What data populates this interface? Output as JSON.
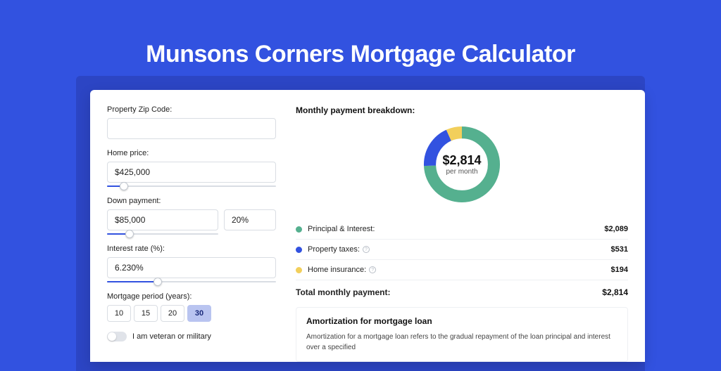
{
  "hero": {
    "title": "Munsons Corners Mortgage Calculator"
  },
  "form": {
    "zip_label": "Property Zip Code:",
    "zip_value": "",
    "home_price_label": "Home price:",
    "home_price_value": "$425,000",
    "home_price_slider_percent": 10,
    "down_payment_label": "Down payment:",
    "down_payment_value": "$85,000",
    "down_payment_percent_value": "20%",
    "down_payment_slider_percent": 20,
    "interest_label": "Interest rate (%):",
    "interest_value": "6.230%",
    "interest_slider_percent": 30,
    "period_label": "Mortgage period (years):",
    "period_options": [
      "10",
      "15",
      "20",
      "30"
    ],
    "period_selected": "30",
    "veteran_label": "I am veteran or military",
    "veteran_on": false
  },
  "breakdown": {
    "title": "Monthly payment breakdown:",
    "donut_value": "$2,814",
    "donut_sub": "per month",
    "items": [
      {
        "label": "Principal & Interest:",
        "value": "$2,089",
        "color": "#55b08f",
        "has_info": false
      },
      {
        "label": "Property taxes:",
        "value": "$531",
        "color": "#3252e0",
        "has_info": true
      },
      {
        "label": "Home insurance:",
        "value": "$194",
        "color": "#f2cf5b",
        "has_info": true
      }
    ],
    "total_label": "Total monthly payment:",
    "total_value": "$2,814"
  },
  "chart_data": {
    "type": "pie",
    "title": "Monthly payment breakdown",
    "center_value": 2814,
    "center_unit": "per month",
    "series": [
      {
        "name": "Principal & Interest",
        "value": 2089,
        "color": "#55b08f"
      },
      {
        "name": "Property taxes",
        "value": 531,
        "color": "#3252e0"
      },
      {
        "name": "Home insurance",
        "value": 194,
        "color": "#f2cf5b"
      }
    ]
  },
  "amortization": {
    "title": "Amortization for mortgage loan",
    "text": "Amortization for a mortgage loan refers to the gradual repayment of the loan principal and interest over a specified"
  }
}
